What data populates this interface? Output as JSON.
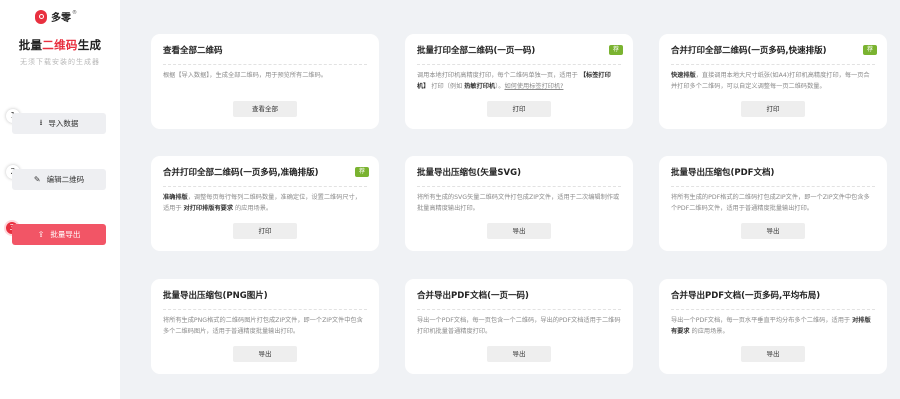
{
  "brand": {
    "name": "多零",
    "reg": "®"
  },
  "app": {
    "title_pre": "批量",
    "title_hl": "二维码",
    "title_post": "生成",
    "subtitle": "无须下载安装的生成器"
  },
  "steps": [
    {
      "num": "1",
      "label": "导入数据",
      "icon": "download-icon"
    },
    {
      "num": "2",
      "label": "编辑二维码",
      "icon": "edit-icon"
    },
    {
      "num": "3",
      "label": "批量导出",
      "icon": "export-icon",
      "active": true
    }
  ],
  "colors": {
    "accent": "#e8303f",
    "badge": "#7ab330",
    "active_step": "#f25566"
  },
  "cards": [
    {
      "title": "查看全部二维码",
      "desc_parts": [
        "根据【导入数据】，生成全部二维码，用于预览所有二维码。"
      ],
      "action": "查看全部"
    },
    {
      "title": "批量打印全部二维码(一页一码)",
      "badge": "荐",
      "desc_parts": [
        "调用本地打印机高精度打印，每个二维码单独一页，适用于 ",
        "【标签打印机】",
        " 打印（例如 ",
        "热敏打印机",
        "）。",
        "如何使用标签打印机?"
      ],
      "action": "打印"
    },
    {
      "title": "合并打印全部二维码(一页多码,快速排版)",
      "badge": "荐",
      "desc_parts": [
        "快速排版",
        "，直接调用本地大尺寸纸张(如A4)打印机高精度打印，每一页合并打印多个二维码，可以自定义调整每一页二维码数量。"
      ],
      "action": "打印"
    },
    {
      "title": "合并打印全部二维码(一页多码,准确排版)",
      "badge": "荐",
      "desc_parts": [
        "准确排版",
        "，调整每页每行每列二维码数量，准确定位，设置二维码尺寸，适用于 ",
        "对打印排版有要求",
        " 的应用场景。"
      ],
      "action": "打印"
    },
    {
      "title": "批量导出压缩包(矢量SVG)",
      "desc_parts": [
        "将所有生成的SVG矢量二维码文件打包成ZIP文件，适用于二次编辑制作或批量高精度输出打印。"
      ],
      "action": "导出"
    },
    {
      "title": "批量导出压缩包(PDF文档)",
      "desc_parts": [
        "将所有生成的PDF格式的二维码打包成ZIP文件，即一个ZIP文件中包含多个PDF二维码文件，适用于普通精度批量输出打印。"
      ],
      "action": "导出"
    },
    {
      "title": "批量导出压缩包(PNG图片)",
      "desc_parts": [
        "将所有生成PNG格式的二维码图片打包成ZIP文件，即一个ZIP文件中包含多个二维码图片，适用于普通精度批量输出打印。"
      ],
      "action": "导出"
    },
    {
      "title": "合并导出PDF文档(一页一码)",
      "desc_parts": [
        "导出一个PDF文档，每一页包含一个二维码，导出的PDF文档适用于二维码打印机批量普通精度打印。"
      ],
      "action": "导出"
    },
    {
      "title": "合并导出PDF文档(一页多码,平均布局)",
      "desc_parts": [
        "导出一个PDF文档，每一页水平垂直平均分布多个二维码，适用于 ",
        "对排版有要求",
        " 的应用场景。"
      ],
      "action": "导出"
    }
  ]
}
